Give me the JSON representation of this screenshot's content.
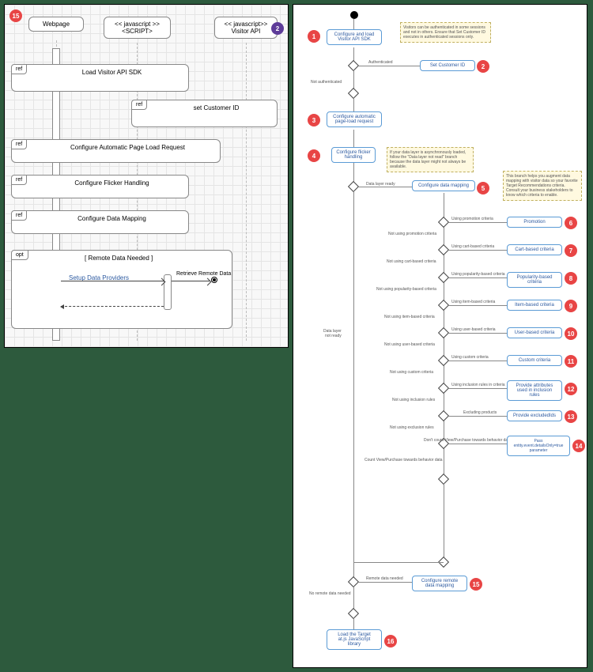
{
  "left": {
    "lifelines": [
      "Webpage",
      "<< javascript >>\n<SCRIPT>",
      "<< javascript>>\nVisitor API"
    ],
    "frags": [
      {
        "label": "ref",
        "title": "Load Visitor API SDK"
      },
      {
        "label": "ref",
        "title": "set Customer ID"
      },
      {
        "label": "ref",
        "title": "Configure Automatic Page Load Request"
      },
      {
        "label": "ref",
        "title": "Configure Flicker Handling"
      },
      {
        "label": "ref",
        "title": "Configure Data Mapping"
      },
      {
        "label": "opt",
        "title": "[ Remote Data Needed ]"
      }
    ],
    "setup_link": "Setup Data Providers",
    "retrieve": "Retrieve Remote Data",
    "badge_top": "15",
    "badge_right": "2"
  },
  "right": {
    "nodes": {
      "n1": "Configure and load\nVisitor API SDK",
      "n2": "Set Customer ID",
      "n3": "Configure automatic\npage-load request",
      "n4": "Configure\nflicker handling",
      "n5": "Configure data mapping",
      "n6": "Promotion",
      "n7": "Cart-based criteria",
      "n8": "Popularity-based criteria",
      "n9": "Item-based criteria",
      "n10": "User-based criteria",
      "n11": "Custom criteria",
      "n12": "Provide attributes\nused in inclusion rules",
      "n13": "Provide excludedIds",
      "n14": "Pass\nentity.event.detailsOnly=true\nparameter",
      "n15": "Configure remote\ndata mapping",
      "n16": "Load the Target\nat.js JavaScript\nlibrary"
    },
    "labels": {
      "auth": "Authenticated",
      "notauth": "Not authenticated",
      "dlready": "Data layer ready",
      "dlnotready": "Data layer\nnot ready",
      "l6a": "Using promotion criteria",
      "l6b": "Not using promotion criteria",
      "l7a": "Using cart-based criteria",
      "l7b": "Not using cart-based criteria",
      "l8a": "Using popularity-based criteria",
      "l8b": "Not using popularity-based criteria",
      "l9a": "Using item-based criteria",
      "l9b": "Not using item-based criteria",
      "l10a": "Using user-based criteria",
      "l10b": "Not using user-based criteria",
      "l11a": "Using custom criteria",
      "l11b": "Not using custom criteria",
      "l12a": "Using inclusion rules in criteria",
      "l12b": "Not using inclusion rules",
      "l13a": "Excluding products",
      "l13b": "Not using exclusion rules",
      "l14a": "Don't count View/Purchase towards behavior data",
      "l14b": "Count View/Purchase towards behavior data",
      "l15a": "Remote data needed",
      "l15b": "No remote data needed"
    },
    "notes": {
      "note1": "Visitors can be authenticated in some sessions and not in others. Ensure that Set Customer ID executes in authenticated sessions only.",
      "note2": "If your data layer is asynchronously loaded, follow the \"Data layer not read\" branch because the data layer might not always be available.",
      "note3": "This branch helps you augment data mapping with visitor data so your favorite Target Recommendations criteria. Consult your business stakeholders to know which criteria to enable."
    },
    "badges": [
      "1",
      "2",
      "3",
      "4",
      "5",
      "6",
      "7",
      "8",
      "9",
      "10",
      "11",
      "12",
      "13",
      "14",
      "15",
      "16"
    ]
  }
}
